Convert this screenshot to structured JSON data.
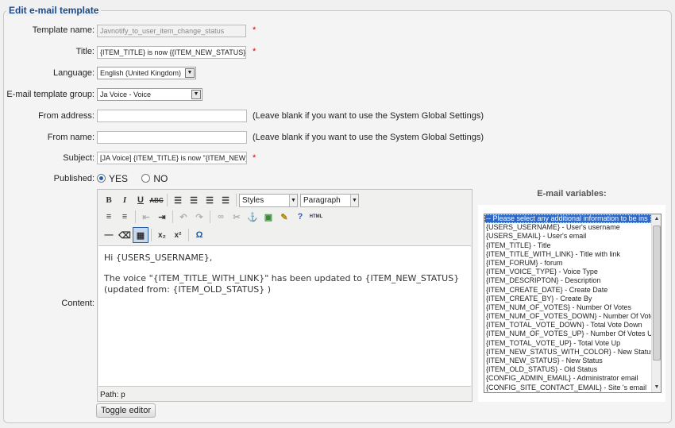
{
  "legend": "Edit e-mail template",
  "fields": {
    "template_name": {
      "label": "Template name:",
      "value": "Javnotify_to_user_item_change_status",
      "required": "*"
    },
    "title": {
      "label": "Title:",
      "value": "{ITEM_TITLE} is now {{ITEM_NEW_STATUS}}",
      "required": "*"
    },
    "language": {
      "label": "Language:",
      "value": "English (United Kingdom)"
    },
    "group": {
      "label": "E-mail template group:",
      "value": "Ja Voice - Voice"
    },
    "from_address": {
      "label": "From address:",
      "value": "",
      "note": "(Leave blank if you want to use the System Global Settings)"
    },
    "from_name": {
      "label": "From name:",
      "value": "",
      "note": "(Leave blank if you want to use the System Global Settings)"
    },
    "subject": {
      "label": "Subject:",
      "value": "[JA Voice] {ITEM_TITLE} is now \"{ITEM_NEW_",
      "required": "*"
    },
    "published": {
      "label": "Published:",
      "yes": "YES",
      "no": "NO",
      "selected": "YES"
    },
    "content": {
      "label": "Content:"
    }
  },
  "editor": {
    "styles": "Styles",
    "format": "Paragraph",
    "body_line1": "Hi {USERS_USERNAME},",
    "body_line2": "The voice \"{ITEM_TITLE_WITH_LINK}\" has been updated to {ITEM_NEW_STATUS} (updated from: {ITEM_OLD_STATUS} )",
    "path": "Path: p",
    "toggle_label": "Toggle editor"
  },
  "variables": {
    "title": "E-mail variables:",
    "options": [
      "-- Please select any additional information to be ins",
      "{USERS_USERNAME} - User's username",
      "{USERS_EMAIL} - User's email",
      "{ITEM_TITLE} - Title",
      "{ITEM_TITLE_WITH_LINK} - Title with link",
      "{ITEM_FORUM} - forum",
      "{ITEM_VOICE_TYPE} - Voice Type",
      "{ITEM_DESCRIPTON} - Description",
      "{ITEM_CREATE_DATE} - Create Date",
      "{ITEM_CREATE_BY} - Create By",
      "{ITEM_NUM_OF_VOTES} - Number Of Votes",
      "{ITEM_NUM_OF_VOTES_DOWN} - Number Of Vote",
      "{ITEM_TOTAL_VOTE_DOWN} - Total Vote Down",
      "{ITEM_NUM_OF_VOTES_UP} - Number Of Votes U",
      "{ITEM_TOTAL_VOTE_UP} - Total Vote Up",
      "{ITEM_NEW_STATUS_WITH_COLOR} - New Status",
      "{ITEM_NEW_STATUS} - New Status",
      "{ITEM_OLD_STATUS} - Old Status",
      "{CONFIG_ADMIN_EMAIL} - Administrator email",
      "{CONFIG_SITE_CONTACT_EMAIL} - Site 's email"
    ]
  },
  "colors": {
    "legend": "#1a4a8a",
    "required": "#dd0000",
    "selection": "#3067c3"
  }
}
